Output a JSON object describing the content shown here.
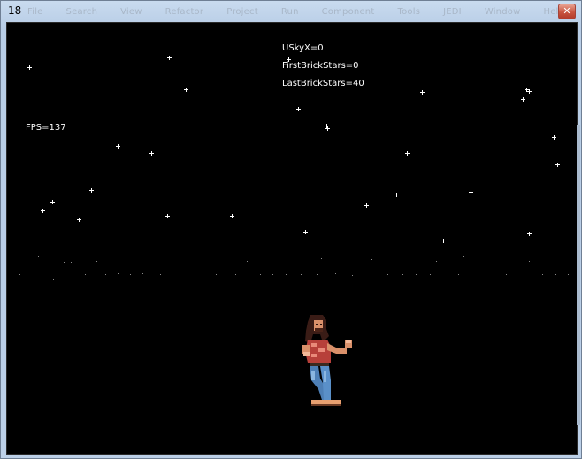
{
  "window": {
    "title": "18",
    "close_glyph": "✕",
    "menu_ghost": [
      "File",
      "Search",
      "View",
      "Refactor",
      "Project",
      "Run",
      "Component",
      "Tools",
      "JEDI",
      "Window",
      "Help"
    ]
  },
  "hud": {
    "usky": "USkyX=0",
    "first_brick": "FirstBrickStars=0",
    "last_brick": "LastBrickStars=40",
    "fps": "FPS=137"
  },
  "scene": {
    "background": "#000000",
    "star_color": "#ffffff",
    "character": "fighter-sprite"
  }
}
